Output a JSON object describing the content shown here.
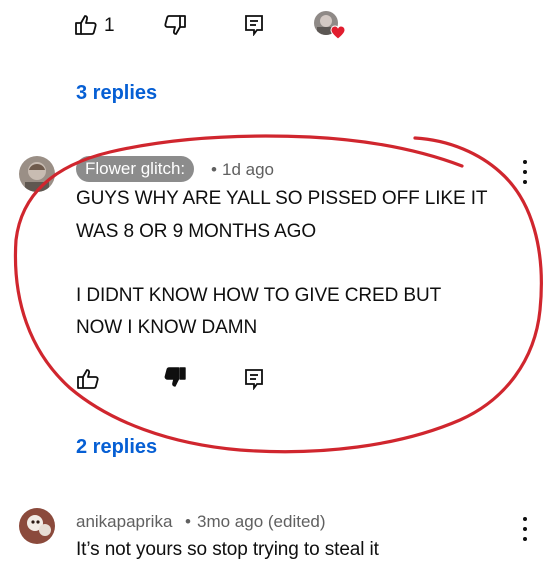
{
  "top_actions": {
    "like_count": "1"
  },
  "first_thread": {
    "replies_label": "3 replies"
  },
  "comment": {
    "author": "Flower glitch:",
    "separator": "•",
    "time": "1d ago",
    "lines": [
      "GUYS WHY ARE YALL SO PISSED OFF LIKE IT",
      "WAS 8 OR 9 MONTHS AGO",
      "I DIDNT KNOW HOW TO GIVE CRED BUT",
      "NOW I KNOW DAMN"
    ],
    "replies_label": "2 replies"
  },
  "next_comment": {
    "author": "anikapaprika",
    "separator": "•",
    "time": "3mo ago (edited)",
    "text": "It’s not yours so stop trying to steal it"
  },
  "colors": {
    "link": "#065fd4",
    "annotation_circle": "#d0262e",
    "heart": "#e11d2e",
    "author_chip": "#8c8c8c"
  },
  "icons": [
    "thumbs-up-icon",
    "thumbs-down-icon",
    "reply-icon",
    "heart-icon",
    "more-options-icon"
  ]
}
